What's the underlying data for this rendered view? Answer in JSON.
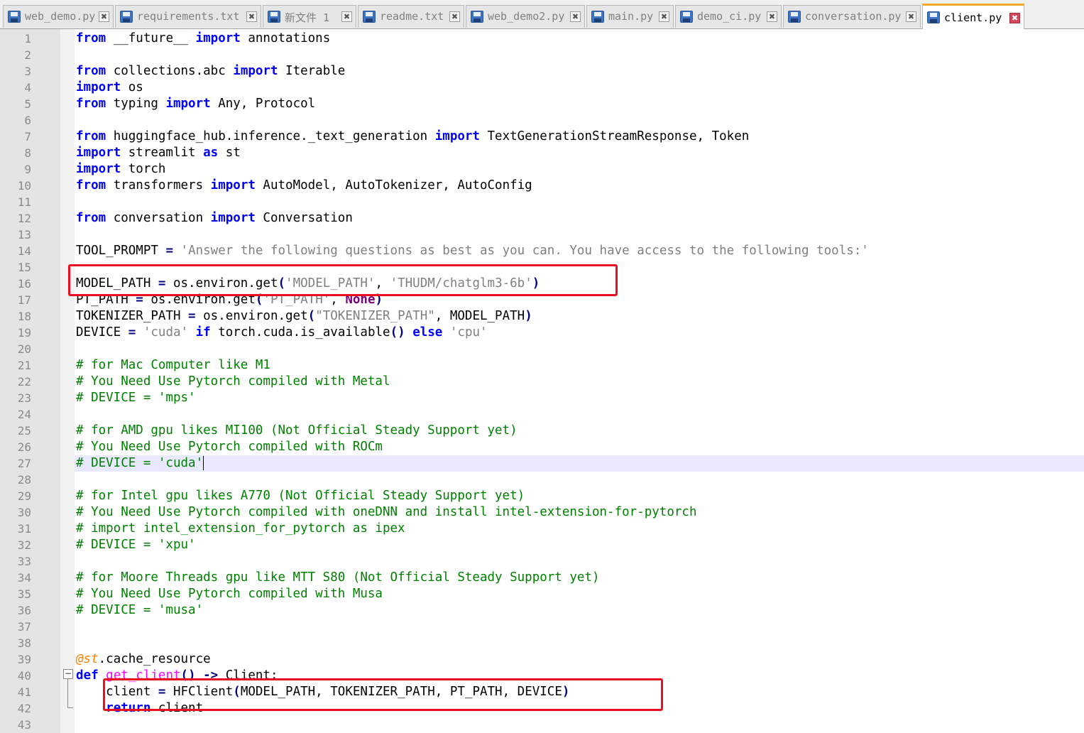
{
  "tabs": [
    {
      "label": "web_demo.py",
      "active": false
    },
    {
      "label": "requirements.txt",
      "active": false
    },
    {
      "label": "新文件 1",
      "active": false
    },
    {
      "label": "readme.txt",
      "active": false
    },
    {
      "label": "web_demo2.py",
      "active": false
    },
    {
      "label": "main.py",
      "active": false
    },
    {
      "label": "demo_ci.py",
      "active": false
    },
    {
      "label": "conversation.py",
      "active": false
    },
    {
      "label": "client.py",
      "active": true
    }
  ],
  "tab_close_glyph": "✖",
  "fold_marker": "−",
  "colors": {
    "keyword": "#0000ff",
    "string": "#808080",
    "comment": "#008000",
    "highlight_box": "#e8101e",
    "active_tab_accent": "#f5a623"
  },
  "editor": {
    "current_line": 27,
    "line_numbers": [
      "1",
      "2",
      "3",
      "4",
      "5",
      "6",
      "7",
      "8",
      "9",
      "10",
      "11",
      "12",
      "13",
      "14",
      "15",
      "16",
      "17",
      "18",
      "19",
      "20",
      "21",
      "22",
      "23",
      "24",
      "25",
      "26",
      "27",
      "28",
      "29",
      "30",
      "31",
      "32",
      "33",
      "34",
      "35",
      "36",
      "37",
      "38",
      "39",
      "40",
      "41",
      "42",
      "43"
    ],
    "lines": [
      [
        [
          "kw",
          "from"
        ],
        [
          "t",
          " __future__ "
        ],
        [
          "kw",
          "import"
        ],
        [
          "t",
          " annotations"
        ]
      ],
      [],
      [
        [
          "kw",
          "from"
        ],
        [
          "t",
          " collections.abc "
        ],
        [
          "kw",
          "import"
        ],
        [
          "t",
          " Iterable"
        ]
      ],
      [
        [
          "kw",
          "import"
        ],
        [
          "t",
          " os"
        ]
      ],
      [
        [
          "kw",
          "from"
        ],
        [
          "t",
          " typing "
        ],
        [
          "kw",
          "import"
        ],
        [
          "t",
          " Any, Protocol"
        ]
      ],
      [],
      [
        [
          "kw",
          "from"
        ],
        [
          "t",
          " huggingface_hub.inference._text_generation "
        ],
        [
          "kw",
          "import"
        ],
        [
          "t",
          " TextGenerationStreamResponse, Token"
        ]
      ],
      [
        [
          "kw",
          "import"
        ],
        [
          "t",
          " streamlit "
        ],
        [
          "kw",
          "as"
        ],
        [
          "t",
          " st"
        ]
      ],
      [
        [
          "kw",
          "import"
        ],
        [
          "t",
          " torch"
        ]
      ],
      [
        [
          "kw",
          "from"
        ],
        [
          "t",
          " transformers "
        ],
        [
          "kw",
          "import"
        ],
        [
          "t",
          " AutoModel, AutoTokenizer, AutoConfig"
        ]
      ],
      [],
      [
        [
          "kw",
          "from"
        ],
        [
          "t",
          " conversation "
        ],
        [
          "kw",
          "import"
        ],
        [
          "t",
          " Conversation"
        ]
      ],
      [],
      [
        [
          "t",
          "TOOL_PROMPT "
        ],
        [
          "op",
          "="
        ],
        [
          "t",
          " "
        ],
        [
          "str",
          "'Answer the following questions as best as you can. You have access to the following tools:'"
        ]
      ],
      [],
      [
        [
          "t",
          "MODEL_PATH "
        ],
        [
          "op",
          "="
        ],
        [
          "t",
          " os.environ.get"
        ],
        [
          "op",
          "("
        ],
        [
          "str",
          "'MODEL_PATH'"
        ],
        [
          "t",
          ", "
        ],
        [
          "str",
          "'THUDM/chatglm3-6b'"
        ],
        [
          "op",
          ")"
        ]
      ],
      [
        [
          "t",
          "PT_PATH "
        ],
        [
          "op",
          "="
        ],
        [
          "t",
          " os.environ.get"
        ],
        [
          "op",
          "("
        ],
        [
          "str",
          "'PT_PATH'"
        ],
        [
          "t",
          ", "
        ],
        [
          "kw2",
          "None"
        ],
        [
          "op",
          ")"
        ]
      ],
      [
        [
          "t",
          "TOKENIZER_PATH "
        ],
        [
          "op",
          "="
        ],
        [
          "t",
          " os.environ.get"
        ],
        [
          "op",
          "("
        ],
        [
          "str",
          "\"TOKENIZER_PATH\""
        ],
        [
          "t",
          ", MODEL_PATH"
        ],
        [
          "op",
          ")"
        ]
      ],
      [
        [
          "t",
          "DEVICE "
        ],
        [
          "op",
          "="
        ],
        [
          "t",
          " "
        ],
        [
          "str",
          "'cuda'"
        ],
        [
          "t",
          " "
        ],
        [
          "kw",
          "if"
        ],
        [
          "t",
          " torch.cuda.is_available"
        ],
        [
          "op",
          "()"
        ],
        [
          "t",
          " "
        ],
        [
          "kw",
          "else"
        ],
        [
          "t",
          " "
        ],
        [
          "str",
          "'cpu'"
        ]
      ],
      [],
      [
        [
          "cmt",
          "# for Mac Computer like M1"
        ]
      ],
      [
        [
          "cmt",
          "# You Need Use Pytorch compiled with Metal"
        ]
      ],
      [
        [
          "cmt",
          "# DEVICE = 'mps'"
        ]
      ],
      [],
      [
        [
          "cmt",
          "# for AMD gpu likes MI100 (Not Official Steady Support yet)"
        ]
      ],
      [
        [
          "cmt",
          "# You Need Use Pytorch compiled with ROCm"
        ]
      ],
      [
        [
          "cmt",
          "# DEVICE = 'cuda'"
        ]
      ],
      [],
      [
        [
          "cmt",
          "# for Intel gpu likes A770 (Not Official Steady Support yet)"
        ]
      ],
      [
        [
          "cmt",
          "# You Need Use Pytorch compiled with oneDNN and install intel-extension-for-pytorch"
        ]
      ],
      [
        [
          "cmt",
          "# import intel_extension_for_pytorch as ipex"
        ]
      ],
      [
        [
          "cmt",
          "# DEVICE = 'xpu'"
        ]
      ],
      [],
      [
        [
          "cmt",
          "# for Moore Threads gpu like MTT S80 (Not Official Steady Support yet)"
        ]
      ],
      [
        [
          "cmt",
          "# You Need Use Pytorch compiled with Musa"
        ]
      ],
      [
        [
          "cmt",
          "# DEVICE = 'musa'"
        ]
      ],
      [],
      [],
      [
        [
          "dec",
          "@st"
        ],
        [
          "t",
          ".cache_resource"
        ]
      ],
      [
        [
          "kw",
          "def"
        ],
        [
          "t",
          " "
        ],
        [
          "fn",
          "get_client"
        ],
        [
          "op",
          "()"
        ],
        [
          "t",
          " "
        ],
        [
          "op",
          "->"
        ],
        [
          "t",
          " Client:"
        ]
      ],
      [
        [
          "t",
          "    client "
        ],
        [
          "op",
          "="
        ],
        [
          "t",
          " HFClient"
        ],
        [
          "op",
          "("
        ],
        [
          "t",
          "MODEL_PATH, TOKENIZER_PATH, PT_PATH, DEVICE"
        ],
        [
          "op",
          ")"
        ]
      ],
      [
        [
          "t",
          "    "
        ],
        [
          "kw",
          "return"
        ],
        [
          "t",
          " client"
        ]
      ],
      []
    ]
  }
}
